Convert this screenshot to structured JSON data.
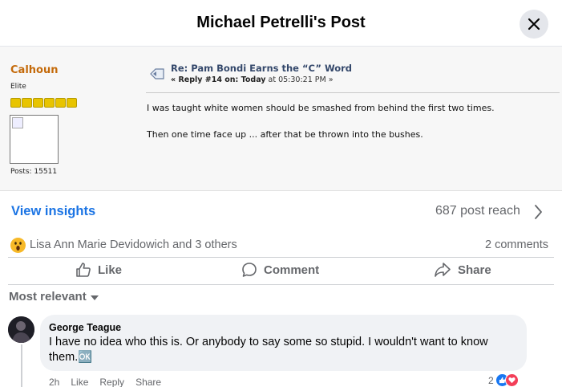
{
  "header": {
    "title": "Michael Petrelli's Post"
  },
  "forum": {
    "username": "Calhoun",
    "rank": "Elite",
    "stars": 6,
    "posts": "Posts: 15511",
    "topic": "Re: Pam Bondi Earns the “C” Word",
    "reply_prefix": "« Reply #14 on: Today",
    "reply_time": " at 05:30:21 PM »",
    "lines": [
      "I was taught white women should be smashed from behind the first two times.",
      "Then one time face up ... after that be thrown into the bushes."
    ]
  },
  "insights": {
    "link": "View insights",
    "reach": "687 post reach"
  },
  "reactions": {
    "emoji": "wow-emoji",
    "names": "Lisa Ann Marie Devidowich and 3 others",
    "comments": "2 comments"
  },
  "actions": {
    "like": "Like",
    "comment": "Comment",
    "share": "Share"
  },
  "sort": {
    "label": "Most relevant"
  },
  "comment": {
    "author": "George Teague",
    "text": "I have no idea who this is. Or anybody to say some so stupid. I wouldn't want to know them.🆗",
    "meta": [
      "2h",
      "Like",
      "Reply",
      "Share"
    ],
    "reaction_count": "2"
  },
  "colors": {
    "link_blue": "#1b74e4",
    "forum_user": "#c46a0a",
    "muted": "#65676b"
  }
}
